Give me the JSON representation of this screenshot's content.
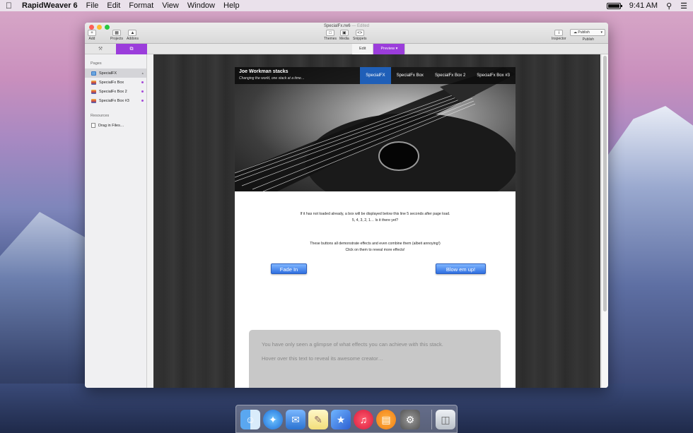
{
  "menubar": {
    "app_name": "RapidWeaver 6",
    "items": [
      "File",
      "Edit",
      "Format",
      "View",
      "Window",
      "Help"
    ],
    "time": "9:41 AM"
  },
  "window": {
    "doc_title": "SpecialFx.rw6",
    "doc_status": "— Edited",
    "toolbar": {
      "add": "Add",
      "projects": "Projects",
      "addons": "Addons",
      "themes": "Themes",
      "media": "Media",
      "snippets": "Snippets",
      "inspector": "Inspector",
      "publish_button": "Publish",
      "publish_label": "Publish"
    },
    "modes": {
      "edit": "Edit",
      "preview": "Preview"
    }
  },
  "sidebar": {
    "pages_header": "Pages",
    "pages": [
      "SpecialFX",
      "SpecialFx Box",
      "SpecialFx Box 2",
      "SpecialFx Box #3"
    ],
    "resources_header": "Resources",
    "resources": [
      "Drag in Files…"
    ]
  },
  "site": {
    "brand": "Joe Workman stacks",
    "tagline": "Changing the world, one stack at a time…",
    "nav": [
      "SpecialFX",
      "SpecialFx Box",
      "SpecialFx Box 2",
      "SpecialFx Box #3"
    ],
    "para1_line1": "If it has not loaded already, a box will be displayed below this line 5 seconds after page load.",
    "para1_line2": "5, 4, 3, 2, 1… Is it there yet?",
    "para2_line1": "These buttons all demonstrate effects and even combine them (albeit annoying!)",
    "para2_line2": "Click on them to reveal more effects!",
    "btn_fade": "Fade In",
    "btn_blow": "Blow em up!",
    "box_line1": "You have only seen a glimpse of what effects you can achieve with this stack.",
    "box_line2": "Hover over this text to reveal its awesome creator…"
  },
  "colors": {
    "accent": "#9b3ddb",
    "nav_active": "#1f5fb8"
  },
  "dock": {
    "icons": [
      "finder-icon",
      "safari-icon",
      "mail-icon",
      "notes-icon",
      "rapidweaver-icon",
      "itunes-icon",
      "ibooks-icon",
      "system-preferences-icon",
      "trash-icon"
    ]
  }
}
